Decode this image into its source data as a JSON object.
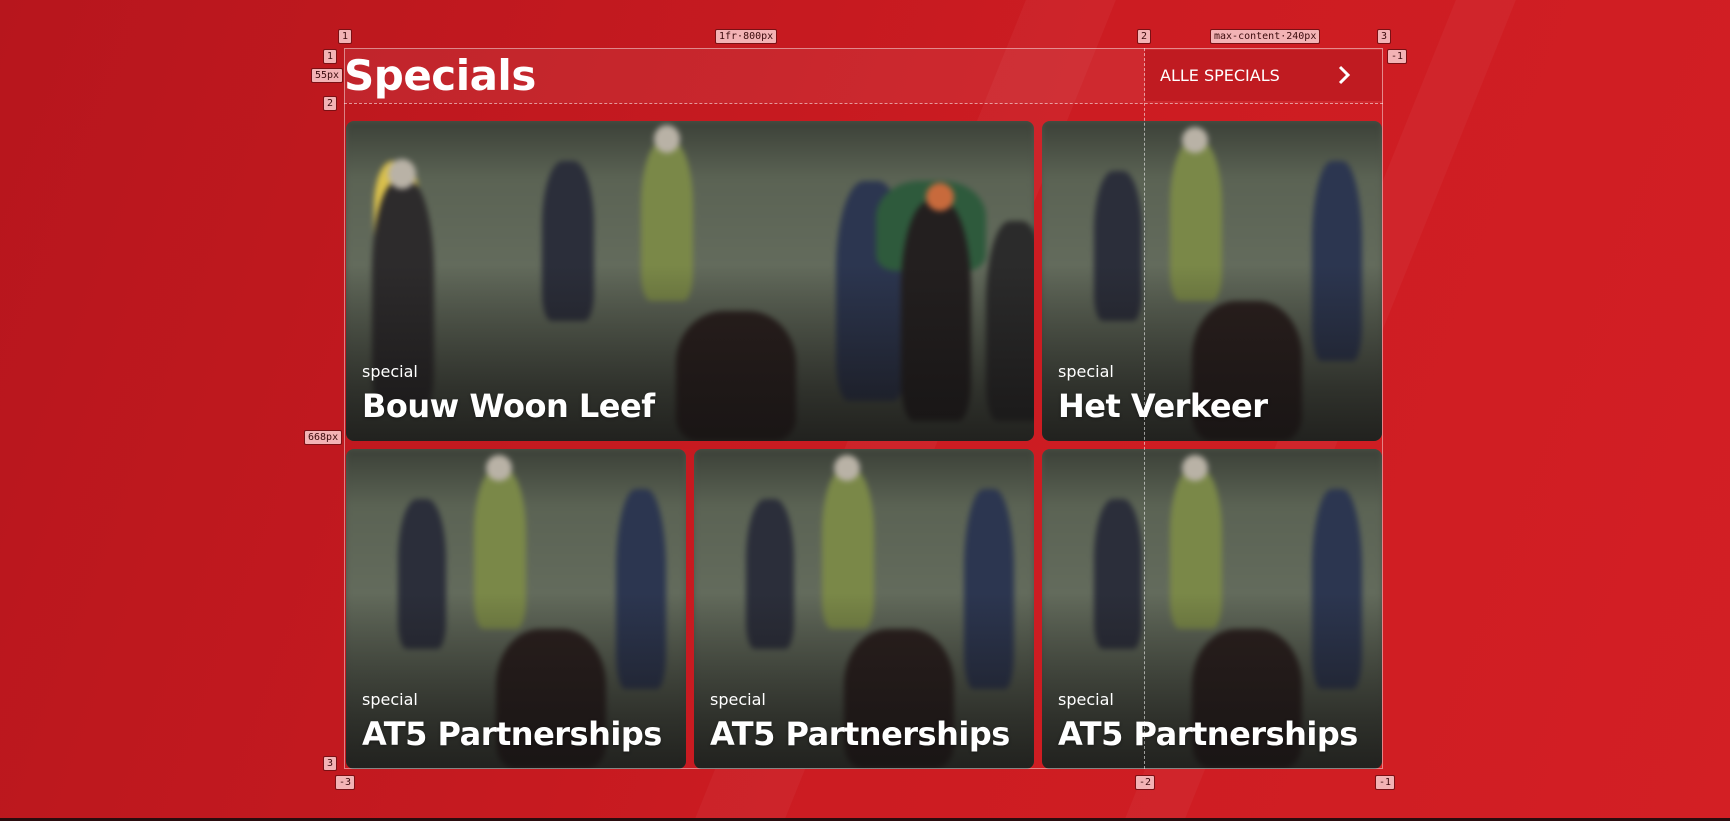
{
  "section": {
    "title": "Specials",
    "all_button_label": "ALLE SPECIALS"
  },
  "cards": [
    {
      "kicker": "special",
      "title": "Bouw Woon Leef"
    },
    {
      "kicker": "special",
      "title": "Het Verkeer"
    },
    {
      "kicker": "special",
      "title": "AT5 Partnerships"
    },
    {
      "kicker": "special",
      "title": "AT5 Partnerships"
    },
    {
      "kicker": "special",
      "title": "AT5 Partnerships"
    }
  ],
  "grid_overlay": {
    "col_line_1": "1",
    "col_line_2": "2",
    "col_line_3": "3",
    "col_track_1": "1fr·800px",
    "col_track_2": "max-content·240px",
    "row_line_1": "1",
    "row_line_2": "2",
    "row_line_3": "3",
    "row_track_1": "55px",
    "row_track_2": "668px",
    "neg_col_end_top": "-1",
    "neg_col_1": "-3",
    "neg_col_2": "-2",
    "neg_col_3": "-1"
  },
  "colors": {
    "background": "#c61a20",
    "button": "#be1920",
    "text": "#ffffff",
    "overlay_label": "#f3b3b5"
  },
  "icons": {
    "chevron": "chevron-right-icon"
  }
}
